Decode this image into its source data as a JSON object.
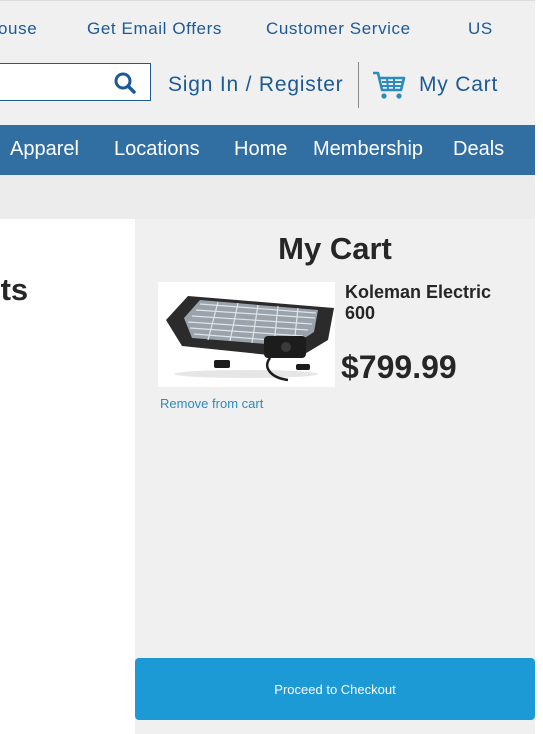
{
  "top_links": {
    "warehouse": "ouse",
    "email_offers": "Get Email Offers",
    "customer_service": "Customer Service",
    "country": "US"
  },
  "header": {
    "search_value": "",
    "search_icon": "search-icon",
    "sign_in": "Sign In / Register",
    "cart_icon": "cart-icon",
    "cart_label": "My Cart"
  },
  "nav": {
    "items": [
      "Apparel",
      "Locations",
      "Home",
      "Membership",
      "Deals"
    ]
  },
  "results": {
    "heading": "lts"
  },
  "cart": {
    "title": "My Cart",
    "items": [
      {
        "name": "Koleman Electric 600",
        "price": "$799.99",
        "remove_label": "Remove from cart"
      }
    ],
    "checkout_label": "Proceed to Checkout"
  },
  "colors": {
    "brand_blue": "#1b5a96",
    "nav_blue": "#316fa2",
    "checkout_blue": "#1b9ad6",
    "link_blue": "#2a8bbf"
  }
}
